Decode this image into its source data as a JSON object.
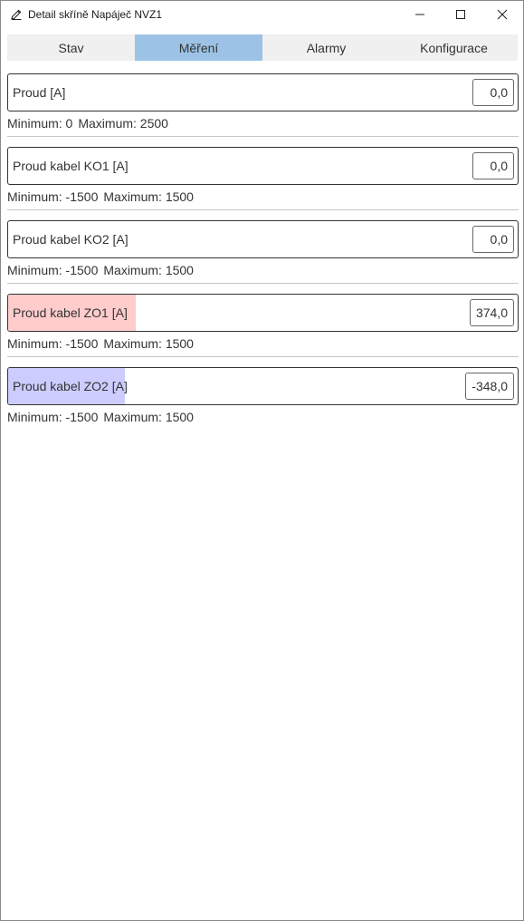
{
  "window": {
    "title": "Detail skříně Napáječ NVZ1",
    "app_icon": "pen-icon",
    "controls": [
      "minimize-icon",
      "maximize-icon",
      "close-icon"
    ]
  },
  "tabs": [
    {
      "label": "Stav",
      "active": false
    },
    {
      "label": "Měření",
      "active": true
    },
    {
      "label": "Alarmy",
      "active": false
    },
    {
      "label": "Konfigurace",
      "active": false
    }
  ],
  "measurements": [
    {
      "label": "Proud [A]",
      "value": "0,0",
      "min_text": "Minimum: 0",
      "max_text": "Maximum: 2500",
      "min": 0,
      "max": 2500,
      "level": 0,
      "fill_color": ""
    },
    {
      "label": "Proud kabel KO1 [A]",
      "value": "0,0",
      "min_text": "Minimum: -1500",
      "max_text": "Maximum: 1500",
      "min": -1500,
      "max": 1500,
      "level": 0,
      "fill_color": ""
    },
    {
      "label": "Proud kabel KO2 [A]",
      "value": "0,0",
      "min_text": "Minimum: -1500",
      "max_text": "Maximum: 1500",
      "min": -1500,
      "max": 1500,
      "level": 0,
      "fill_color": ""
    },
    {
      "label": "Proud kabel ZO1 [A]",
      "value": "374,0",
      "min_text": "Minimum: -1500",
      "max_text": "Maximum: 1500",
      "min": -1500,
      "max": 1500,
      "level": 0.25,
      "fill_color": "#ffcccc"
    },
    {
      "label": "Proud kabel ZO2 [A]",
      "value": "-348,0",
      "min_text": "Minimum: -1500",
      "max_text": "Maximum: 1500",
      "min": -1500,
      "max": 1500,
      "level": 0.23,
      "fill_color": "#ccccff"
    }
  ],
  "colors": {
    "tab_active": "#9cc3e5",
    "tab_bar": "#f0f0f0",
    "positive_fill": "#ffcccc",
    "negative_fill": "#ccccff"
  }
}
